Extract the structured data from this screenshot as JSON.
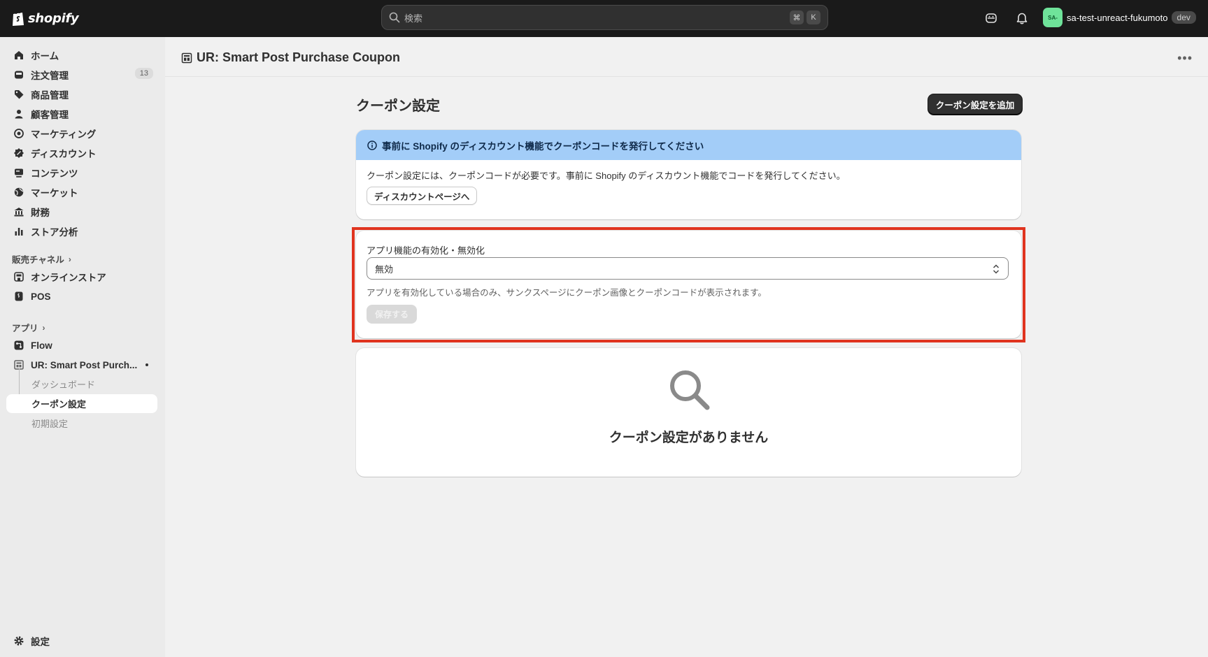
{
  "topbar": {
    "brand": "shopify",
    "search_placeholder": "検索",
    "shortcut_keys": [
      "⌘",
      "K"
    ],
    "account_initials": "SA-",
    "account_name": "sa-test-unreact-fukumoto",
    "account_badge": "dev",
    "icons": [
      "shopify-bag-icon",
      "search-icon",
      "sidekick-icon",
      "bell-icon"
    ]
  },
  "sidebar": {
    "items": [
      {
        "label": "ホーム",
        "icon": "home-icon"
      },
      {
        "label": "注文管理",
        "icon": "inbox-icon",
        "badge": "13"
      },
      {
        "label": "商品管理",
        "icon": "tag-icon"
      },
      {
        "label": "顧客管理",
        "icon": "person-icon"
      },
      {
        "label": "マーケティング",
        "icon": "target-icon"
      },
      {
        "label": "ディスカウント",
        "icon": "discount-icon"
      },
      {
        "label": "コンテンツ",
        "icon": "content-icon"
      },
      {
        "label": "マーケット",
        "icon": "globe-icon"
      },
      {
        "label": "財務",
        "icon": "bank-icon"
      },
      {
        "label": "ストア分析",
        "icon": "chart-icon"
      }
    ],
    "sales_channels_label": "販売チャネル",
    "sales_channels": [
      {
        "label": "オンラインストア",
        "icon": "storefront-icon"
      },
      {
        "label": "POS",
        "icon": "pos-icon"
      }
    ],
    "apps_label": "アプリ",
    "apps": [
      {
        "label": "Flow",
        "icon": "flow-icon"
      },
      {
        "label": "UR: Smart Post Purch...",
        "icon": "app-icon"
      }
    ],
    "app_subitems": [
      "ダッシュボード",
      "クーポン設定",
      "初期設定"
    ],
    "settings_label": "設定"
  },
  "main": {
    "app_title": "UR: Smart Post Purchase Coupon",
    "page_title": "クーポン設定",
    "add_button": "クーポン設定を追加",
    "banner": {
      "title": "事前に Shopify のディスカウント機能でクーポンコードを発行してください",
      "text": "クーポン設定には、クーポンコードが必要です。事前に Shopify のディスカウント機能でコードを発行してください。",
      "button": "ディスカウントページへ"
    },
    "toggle_card": {
      "label": "アプリ機能の有効化・無効化",
      "selected": "無効",
      "help": "アプリを有効化している場合のみ、サンクスページにクーポン画像とクーポンコードが表示されます。",
      "save_button": "保存する"
    },
    "empty_state": {
      "text": "クーポン設定がありません"
    }
  },
  "colors": {
    "topbar_bg": "#1a1a1a",
    "banner_bg": "#a3cdf8",
    "highlight": "#e0341f",
    "avatar_bg": "#6fe39a"
  }
}
